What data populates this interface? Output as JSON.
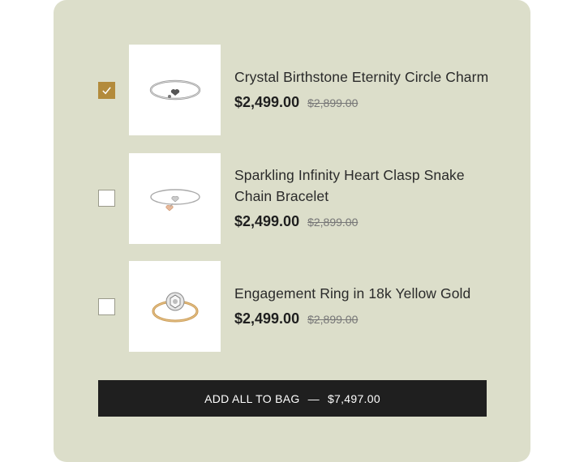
{
  "items": [
    {
      "title": "Crystal Birthstone Eternity Circle Charm",
      "price": "$2,499.00",
      "compare_price": "$2,899.00",
      "checked": true,
      "icon": "bangle-bracelet-icon"
    },
    {
      "title": "Sparkling Infinity Heart Clasp Snake Chain Bracelet",
      "price": "$2,499.00",
      "compare_price": "$2,899.00",
      "checked": false,
      "icon": "heart-bracelet-icon"
    },
    {
      "title": "Engagement Ring in 18k Yellow Gold",
      "price": "$2,499.00",
      "compare_price": "$2,899.00",
      "checked": false,
      "icon": "ring-icon"
    }
  ],
  "bundle_button": {
    "label": "ADD ALL TO BAG",
    "separator": "—",
    "total": "$7,497.00"
  },
  "colors": {
    "panel_bg": "#dcdeca",
    "checkbox_checked": "#b38b3c",
    "button_bg": "#1f1f1f"
  }
}
